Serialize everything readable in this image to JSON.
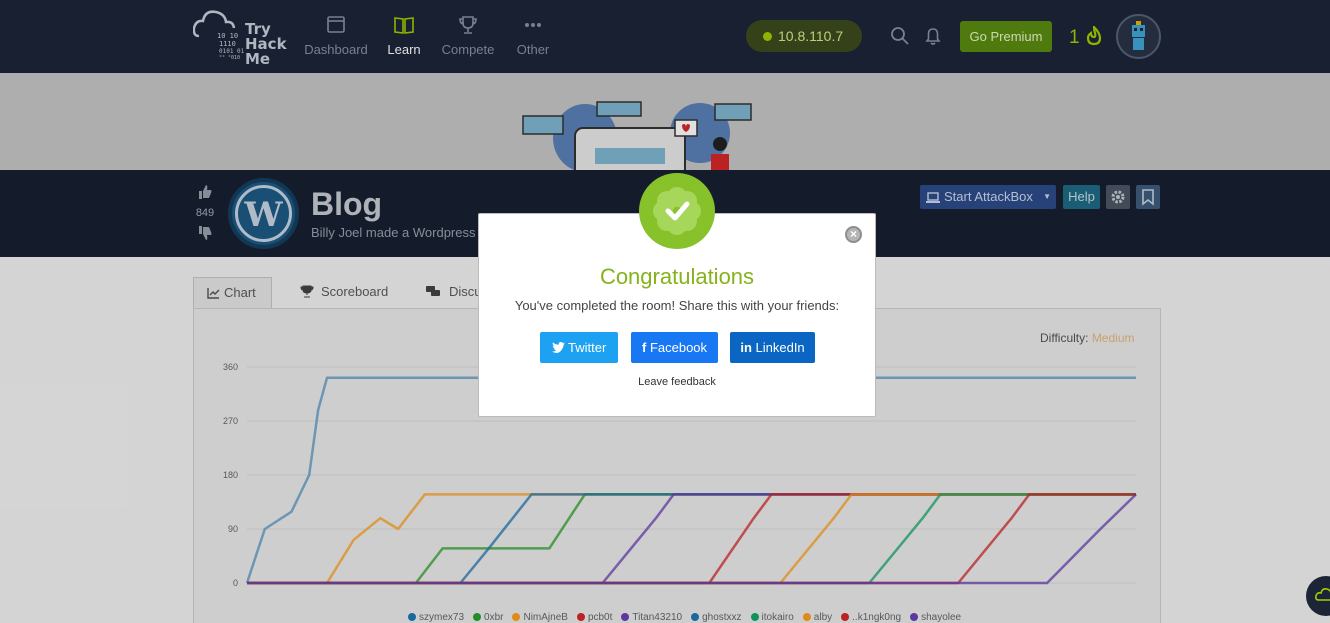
{
  "nav": {
    "logo_text": [
      "Try",
      "Hack",
      "Me"
    ],
    "items": [
      {
        "label": "Dashboard",
        "icon": "dashboard-icon"
      },
      {
        "label": "Learn",
        "icon": "book-icon",
        "active": true
      },
      {
        "label": "Compete",
        "icon": "trophy-icon"
      },
      {
        "label": "Other",
        "icon": "dots-icon"
      }
    ],
    "ip": "10.8.110.7",
    "premium_label": "Go Premium",
    "streak": "1"
  },
  "room": {
    "votes": "849",
    "title": "Blog",
    "subtitle": "Billy Joel made a Wordpress",
    "attackbox_label": "Start AttackBox",
    "help_label": "Help"
  },
  "tabs": [
    {
      "label": "Chart",
      "icon": "chart-icon"
    },
    {
      "label": "Scoreboard",
      "icon": "trophy-icon"
    },
    {
      "label": "Discu",
      "icon": "comments-icon"
    }
  ],
  "difficulty": {
    "label": "Difficulty:",
    "value": "Medium"
  },
  "chart_data": {
    "type": "line",
    "yticks": [
      "360",
      "270",
      "180",
      "90",
      "0"
    ],
    "ylim": [
      0,
      360
    ],
    "series": [
      {
        "name": "szymex73",
        "color": "#1f77b4"
      },
      {
        "name": "0xbr",
        "color": "#2ca02c"
      },
      {
        "name": "NimAjneB",
        "color": "#ff9f1c"
      },
      {
        "name": "pcb0t",
        "color": "#d62728"
      },
      {
        "name": "Titan43210",
        "color": "#6a3fb5"
      },
      {
        "name": "ghostxxz",
        "color": "#1f77b4"
      },
      {
        "name": "itokairo",
        "color": "#13a868"
      },
      {
        "name": "alby",
        "color": "#ff9f1c"
      },
      {
        "name": "..k1ngk0ng",
        "color": "#d62728"
      },
      {
        "name": "shayolee",
        "color": "#6a3fb5"
      }
    ]
  },
  "modal": {
    "title": "Congratulations",
    "message": "You've completed the room! Share this with your friends:",
    "twitter": "Twitter",
    "facebook": "Facebook",
    "linkedin": "LinkedIn",
    "feedback": "Leave feedback",
    "close": "×"
  },
  "colors": {
    "nav_bg": "#1c2538",
    "accent_green": "#84b31a",
    "twitter": "#1da1f2",
    "facebook": "#1877f2",
    "linkedin": "#0a66c2"
  }
}
